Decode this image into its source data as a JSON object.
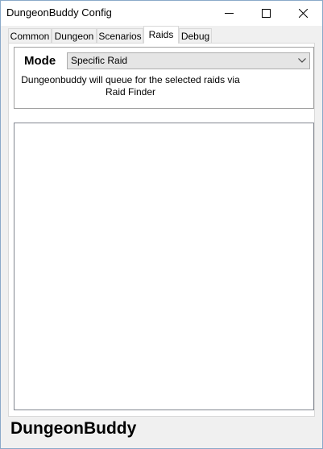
{
  "window": {
    "title": "DungeonBuddy Config"
  },
  "tabs": [
    {
      "label": "Common"
    },
    {
      "label": "Dungeon"
    },
    {
      "label": "Scenarios"
    },
    {
      "label": "Raids"
    },
    {
      "label": "Debug"
    }
  ],
  "active_tab": "Raids",
  "mode": {
    "label": "Mode",
    "selected": "Specific Raid",
    "description": "Dungeonbuddy will queue for the selected raids via Raid Finder"
  },
  "raid_list": {
    "items": []
  },
  "footer": {
    "logo_text": "DungeonBuddy"
  },
  "icons": {
    "minimize": "minimize-icon",
    "maximize": "maximize-icon",
    "close": "close-icon",
    "dropdown": "chevron-down-icon"
  }
}
